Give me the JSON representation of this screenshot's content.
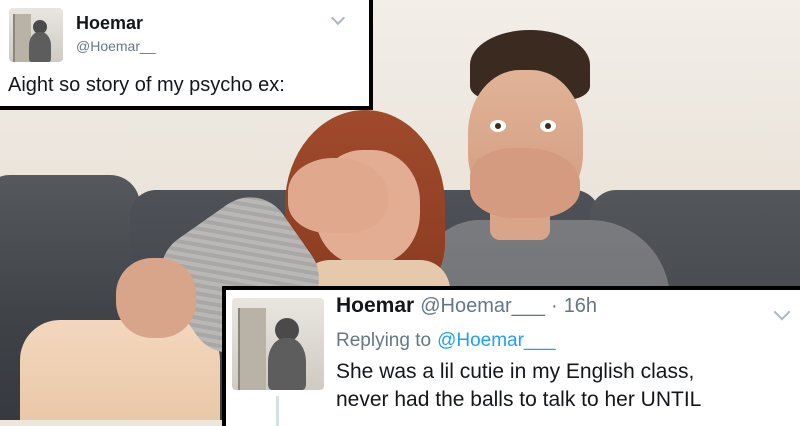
{
  "tweet_top": {
    "display_name": "Hoemar",
    "handle": "@Hoemar__",
    "text": "Aight so story of my psycho ex:"
  },
  "tweet_reply": {
    "display_name": "Hoemar",
    "handle": "@Hoemar___",
    "separator": "·",
    "time": "16h",
    "replying_prefix": "Replying to",
    "replying_handle": "@Hoemar___",
    "body_line1": "She was a lil cutie in my English class,",
    "body_line2": "never had the balls to talk to her UNTIL"
  },
  "icons": {
    "top_menu": "chevron-down-icon",
    "reply_menu": "chevron-down-icon"
  },
  "colors": {
    "name": "#14171a",
    "muted": "#657786",
    "link": "#1da1f2",
    "card_border": "#000000"
  }
}
